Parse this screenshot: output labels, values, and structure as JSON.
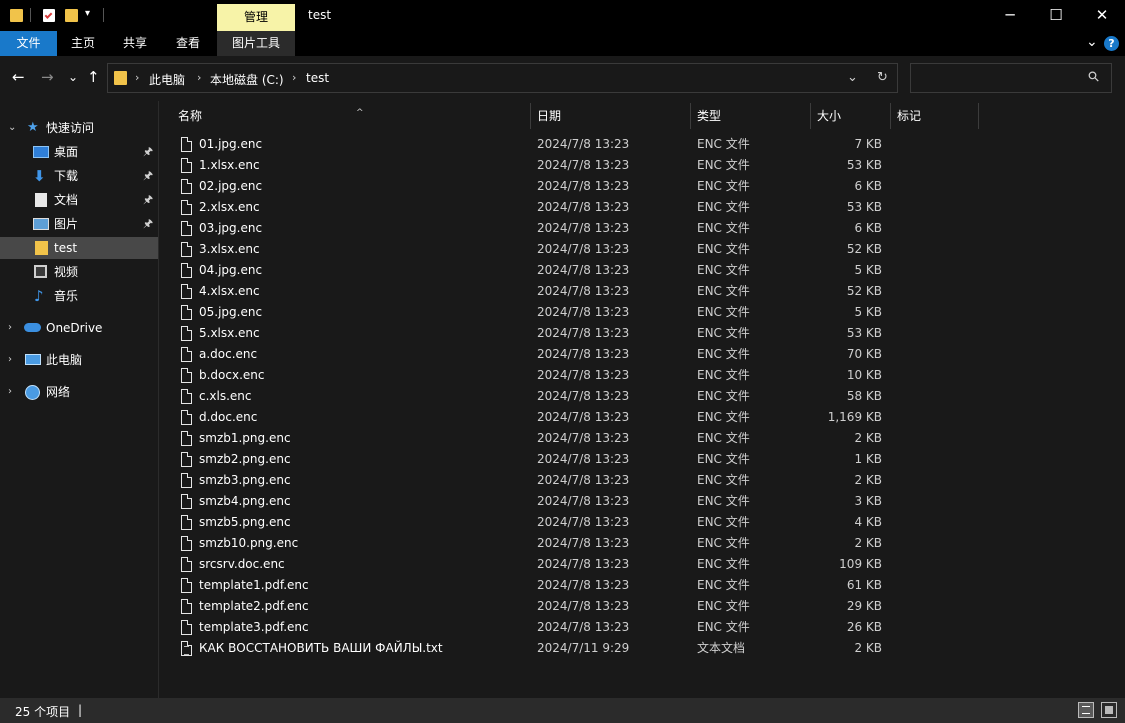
{
  "window": {
    "title": "test",
    "manage_tab": "管理",
    "controls": {
      "minimize": "─",
      "maximize": "☐",
      "close": "✕"
    }
  },
  "ribbon": {
    "tabs": [
      "文件",
      "主页",
      "共享",
      "查看",
      "图片工具"
    ],
    "expand_glyph": "⌄",
    "help_glyph": "?"
  },
  "address_bar": {
    "back": "←",
    "forward": "→",
    "recent": "⌄",
    "up": "↑",
    "crumbs": [
      "此电脑",
      "本地磁盘 (C:)",
      "test"
    ],
    "crumb_separator": "›",
    "dropdown": "⌄",
    "refresh": "↻",
    "search_glyph": "⚲"
  },
  "nav_pane": {
    "quick_access": "快速访问",
    "quick_items": [
      {
        "label": "桌面",
        "pinned": true
      },
      {
        "label": "下载",
        "pinned": true
      },
      {
        "label": "文档",
        "pinned": true
      },
      {
        "label": "图片",
        "pinned": true
      },
      {
        "label": "test",
        "pinned": false
      },
      {
        "label": "视频",
        "pinned": false
      },
      {
        "label": "音乐",
        "pinned": false
      }
    ],
    "onedrive": "OneDrive",
    "this_pc": "此电脑",
    "network": "网络",
    "pin_glyph": "📌",
    "expand_glyph": "›",
    "collapse_glyph": "⌄"
  },
  "columns": {
    "name": "名称",
    "date": "日期",
    "type": "类型",
    "size": "大小",
    "tags": "标记",
    "sort_glyph": "^"
  },
  "files": [
    {
      "name": "01.jpg.enc",
      "date": "2024/7/8 13:23",
      "type": "ENC 文件",
      "size": "7 KB"
    },
    {
      "name": "1.xlsx.enc",
      "date": "2024/7/8 13:23",
      "type": "ENC 文件",
      "size": "53 KB"
    },
    {
      "name": "02.jpg.enc",
      "date": "2024/7/8 13:23",
      "type": "ENC 文件",
      "size": "6 KB"
    },
    {
      "name": "2.xlsx.enc",
      "date": "2024/7/8 13:23",
      "type": "ENC 文件",
      "size": "53 KB"
    },
    {
      "name": "03.jpg.enc",
      "date": "2024/7/8 13:23",
      "type": "ENC 文件",
      "size": "6 KB"
    },
    {
      "name": "3.xlsx.enc",
      "date": "2024/7/8 13:23",
      "type": "ENC 文件",
      "size": "52 KB"
    },
    {
      "name": "04.jpg.enc",
      "date": "2024/7/8 13:23",
      "type": "ENC 文件",
      "size": "5 KB"
    },
    {
      "name": "4.xlsx.enc",
      "date": "2024/7/8 13:23",
      "type": "ENC 文件",
      "size": "52 KB"
    },
    {
      "name": "05.jpg.enc",
      "date": "2024/7/8 13:23",
      "type": "ENC 文件",
      "size": "5 KB"
    },
    {
      "name": "5.xlsx.enc",
      "date": "2024/7/8 13:23",
      "type": "ENC 文件",
      "size": "53 KB"
    },
    {
      "name": "a.doc.enc",
      "date": "2024/7/8 13:23",
      "type": "ENC 文件",
      "size": "70 KB"
    },
    {
      "name": "b.docx.enc",
      "date": "2024/7/8 13:23",
      "type": "ENC 文件",
      "size": "10 KB"
    },
    {
      "name": "c.xls.enc",
      "date": "2024/7/8 13:23",
      "type": "ENC 文件",
      "size": "58 KB"
    },
    {
      "name": "d.doc.enc",
      "date": "2024/7/8 13:23",
      "type": "ENC 文件",
      "size": "1,169 KB"
    },
    {
      "name": "smzb1.png.enc",
      "date": "2024/7/8 13:23",
      "type": "ENC 文件",
      "size": "2 KB"
    },
    {
      "name": "smzb2.png.enc",
      "date": "2024/7/8 13:23",
      "type": "ENC 文件",
      "size": "1 KB"
    },
    {
      "name": "smzb3.png.enc",
      "date": "2024/7/8 13:23",
      "type": "ENC 文件",
      "size": "2 KB"
    },
    {
      "name": "smzb4.png.enc",
      "date": "2024/7/8 13:23",
      "type": "ENC 文件",
      "size": "3 KB"
    },
    {
      "name": "smzb5.png.enc",
      "date": "2024/7/8 13:23",
      "type": "ENC 文件",
      "size": "4 KB"
    },
    {
      "name": "smzb10.png.enc",
      "date": "2024/7/8 13:23",
      "type": "ENC 文件",
      "size": "2 KB"
    },
    {
      "name": "srcsrv.doc.enc",
      "date": "2024/7/8 13:23",
      "type": "ENC 文件",
      "size": "109 KB"
    },
    {
      "name": "template1.pdf.enc",
      "date": "2024/7/8 13:23",
      "type": "ENC 文件",
      "size": "61 KB"
    },
    {
      "name": "template2.pdf.enc",
      "date": "2024/7/8 13:23",
      "type": "ENC 文件",
      "size": "29 KB"
    },
    {
      "name": "template3.pdf.enc",
      "date": "2024/7/8 13:23",
      "type": "ENC 文件",
      "size": "26 KB"
    },
    {
      "name": "КАК ВОССТАНОВИТЬ ВАШИ ФАЙЛЫ.txt",
      "date": "2024/7/11 9:29",
      "type": "文本文档",
      "size": "2 KB"
    }
  ],
  "status": {
    "count": "25 个项目",
    "separator": "|"
  },
  "colors": {
    "accent": "#1979ca",
    "folder": "#f1c34a",
    "manage_tab": "#f7f3a8",
    "background": "#191919"
  }
}
